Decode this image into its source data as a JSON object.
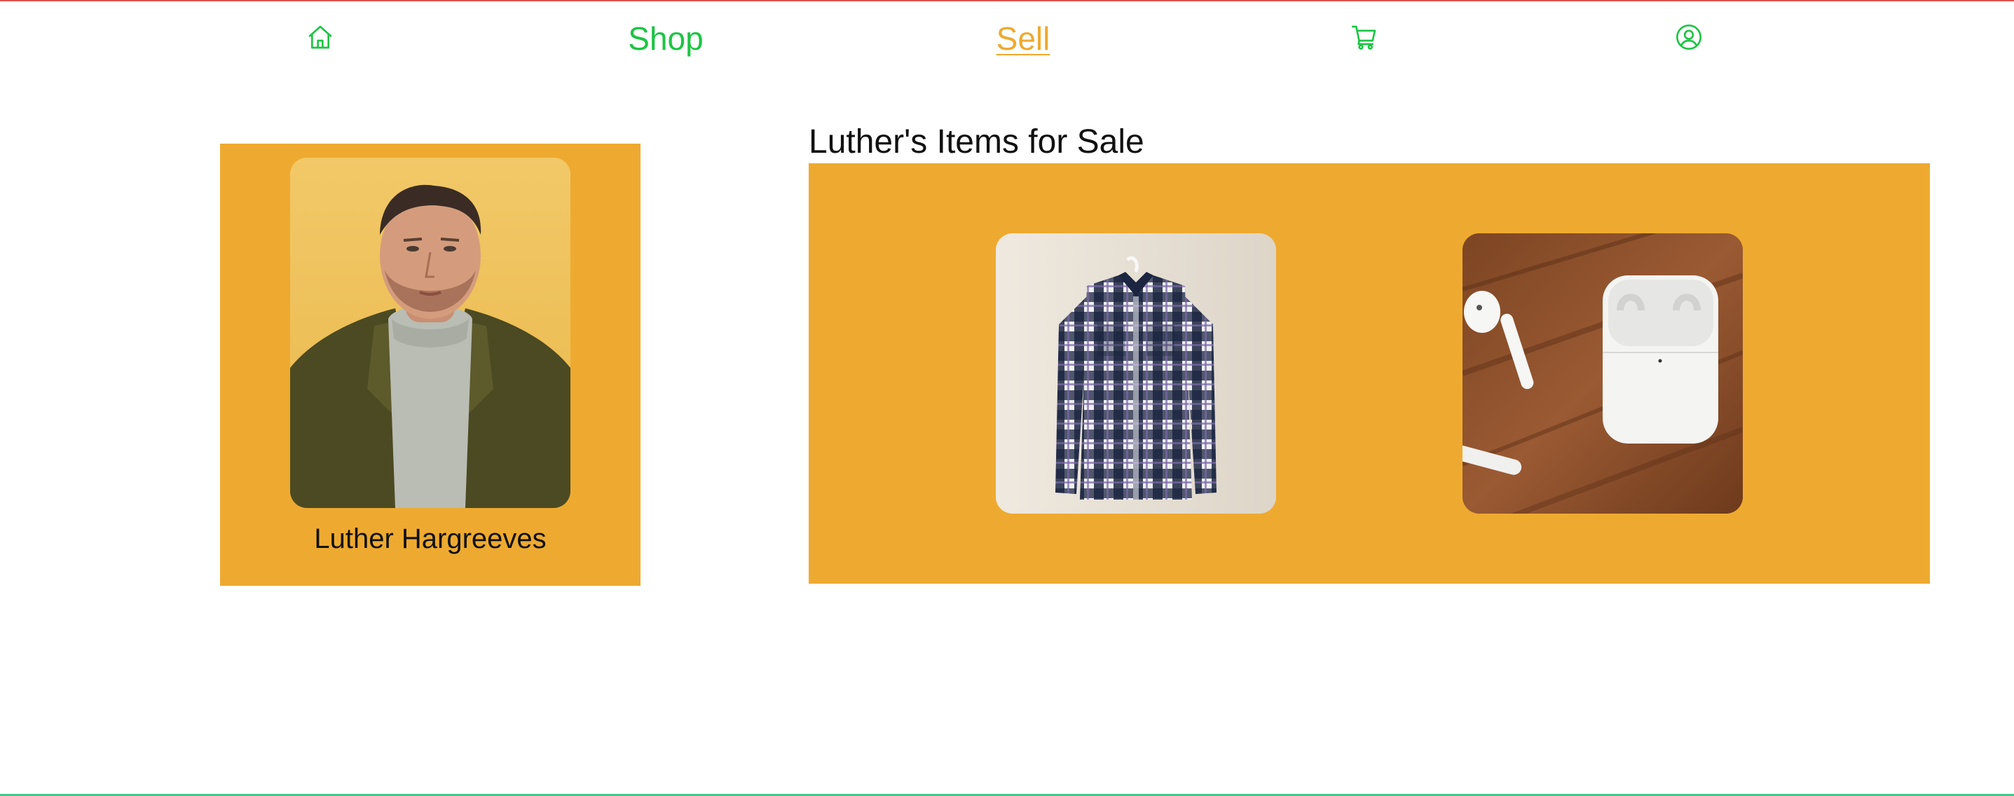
{
  "nav": {
    "home_icon": "home-icon",
    "shop_label": "Shop",
    "sell_label": "Sell",
    "cart_icon": "cart-icon",
    "account_icon": "user-circle-icon",
    "colors": {
      "primary": "#1ec445",
      "active": "#eeaa30"
    }
  },
  "profile": {
    "name": "Luther Hargreeves",
    "card_color": "#eeaa30"
  },
  "items": {
    "heading": "Luther's Items for Sale",
    "list": [
      {
        "image": "plaid-shirt-photo"
      },
      {
        "image": "airpods-photo"
      }
    ]
  }
}
